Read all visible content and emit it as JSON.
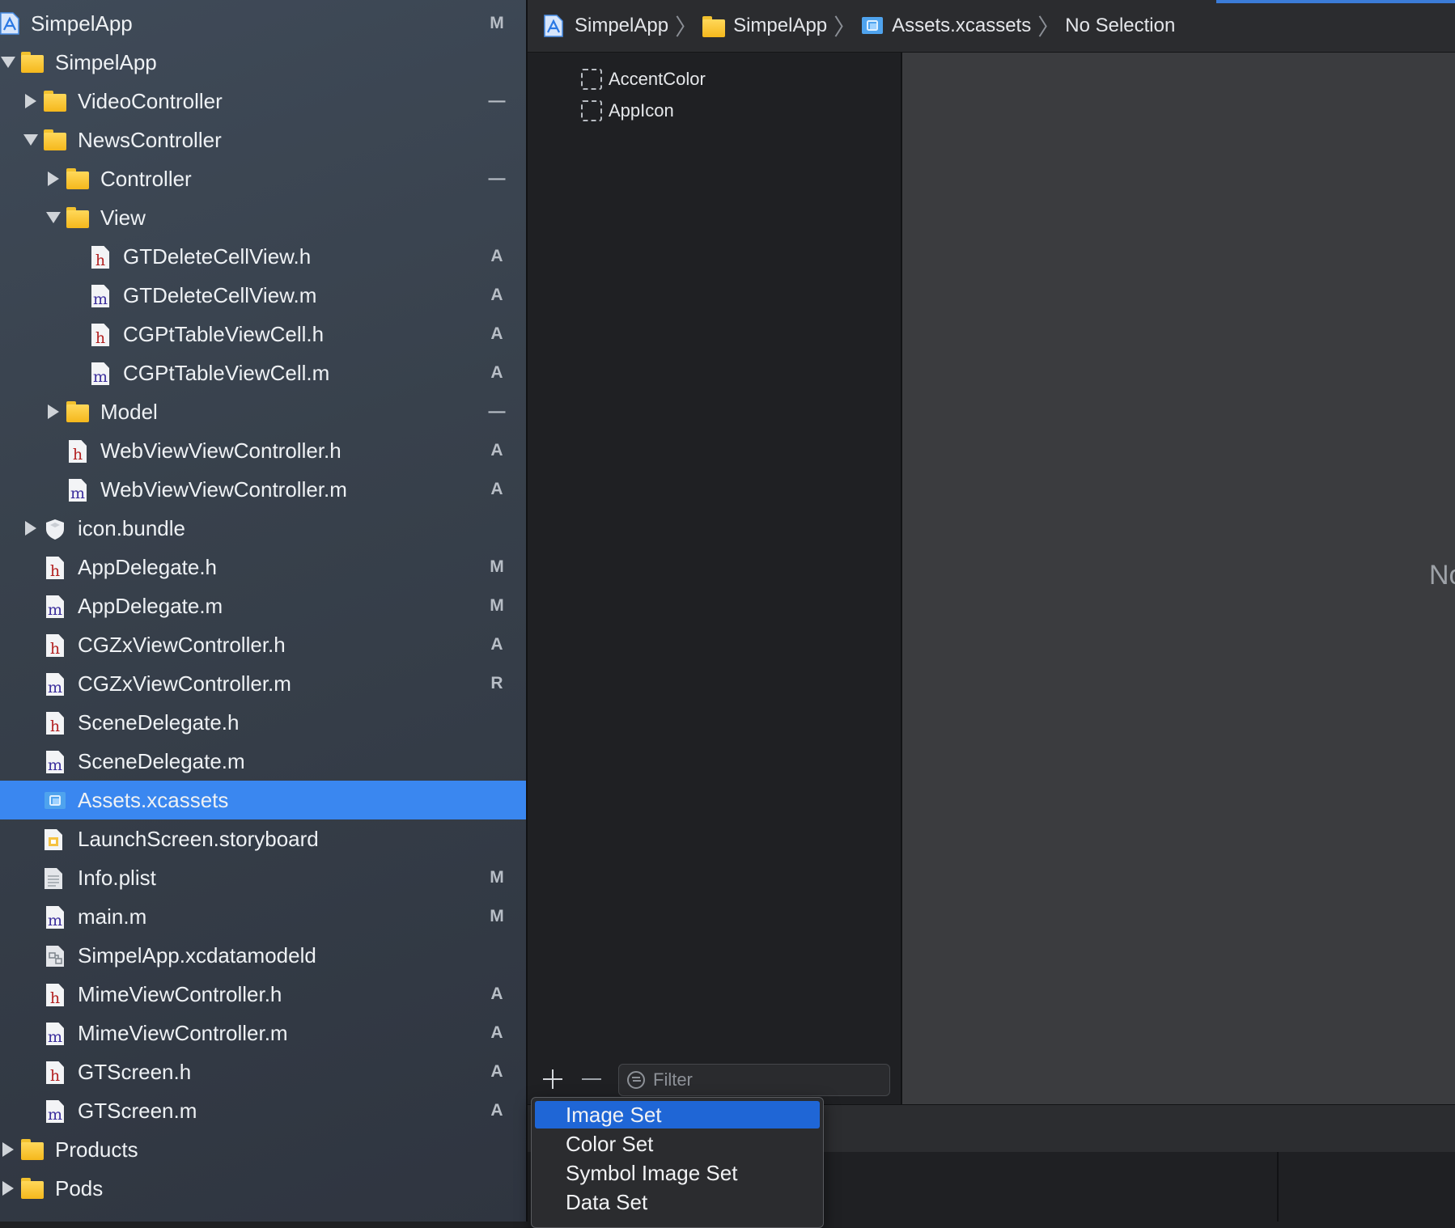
{
  "navigator": {
    "project": {
      "label": "SimpelApp",
      "status": "M"
    },
    "rows": [
      {
        "label": "SimpelApp",
        "type": "folder",
        "indent": 1,
        "disclosure": "open",
        "status": ""
      },
      {
        "label": "VideoController",
        "type": "folder",
        "indent": 2,
        "disclosure": "closed",
        "status": "—"
      },
      {
        "label": "NewsController",
        "type": "folder",
        "indent": 2,
        "disclosure": "open",
        "status": ""
      },
      {
        "label": "Controller",
        "type": "folder",
        "indent": 3,
        "disclosure": "closed",
        "status": "—"
      },
      {
        "label": "View",
        "type": "folder",
        "indent": 3,
        "disclosure": "open",
        "status": ""
      },
      {
        "label": "GTDeleteCellView.h",
        "type": "h",
        "indent": 4,
        "disclosure": "",
        "status": "A"
      },
      {
        "label": "GTDeleteCellView.m",
        "type": "m",
        "indent": 4,
        "disclosure": "",
        "status": "A"
      },
      {
        "label": "CGPtTableViewCell.h",
        "type": "h",
        "indent": 4,
        "disclosure": "",
        "status": "A"
      },
      {
        "label": "CGPtTableViewCell.m",
        "type": "m",
        "indent": 4,
        "disclosure": "",
        "status": "A"
      },
      {
        "label": "Model",
        "type": "folder",
        "indent": 3,
        "disclosure": "closed",
        "status": "—"
      },
      {
        "label": "WebViewViewController.h",
        "type": "h",
        "indent": 3,
        "disclosure": "",
        "status": "A"
      },
      {
        "label": "WebViewViewController.m",
        "type": "m",
        "indent": 3,
        "disclosure": "",
        "status": "A"
      },
      {
        "label": "icon.bundle",
        "type": "bundle",
        "indent": 2,
        "disclosure": "closed",
        "status": ""
      },
      {
        "label": "AppDelegate.h",
        "type": "h",
        "indent": 2,
        "disclosure": "",
        "status": "M"
      },
      {
        "label": "AppDelegate.m",
        "type": "m",
        "indent": 2,
        "disclosure": "",
        "status": "M"
      },
      {
        "label": "CGZxViewController.h",
        "type": "h",
        "indent": 2,
        "disclosure": "",
        "status": "A"
      },
      {
        "label": "CGZxViewController.m",
        "type": "m",
        "indent": 2,
        "disclosure": "",
        "status": "R"
      },
      {
        "label": "SceneDelegate.h",
        "type": "h",
        "indent": 2,
        "disclosure": "",
        "status": ""
      },
      {
        "label": "SceneDelegate.m",
        "type": "m",
        "indent": 2,
        "disclosure": "",
        "status": ""
      },
      {
        "label": "Assets.xcassets",
        "type": "assets",
        "indent": 2,
        "disclosure": "",
        "status": "",
        "selected": true
      },
      {
        "label": "LaunchScreen.storyboard",
        "type": "storyboard",
        "indent": 2,
        "disclosure": "",
        "status": ""
      },
      {
        "label": "Info.plist",
        "type": "plist",
        "indent": 2,
        "disclosure": "",
        "status": "M"
      },
      {
        "label": "main.m",
        "type": "m",
        "indent": 2,
        "disclosure": "",
        "status": "M"
      },
      {
        "label": "SimpelApp.xcdatamodeld",
        "type": "datamodel",
        "indent": 2,
        "disclosure": "",
        "status": ""
      },
      {
        "label": "MimeViewController.h",
        "type": "h",
        "indent": 2,
        "disclosure": "",
        "status": "A"
      },
      {
        "label": "MimeViewController.m",
        "type": "m",
        "indent": 2,
        "disclosure": "",
        "status": "A"
      },
      {
        "label": "GTScreen.h",
        "type": "h",
        "indent": 2,
        "disclosure": "",
        "status": "A"
      },
      {
        "label": "GTScreen.m",
        "type": "m",
        "indent": 2,
        "disclosure": "",
        "status": "A"
      },
      {
        "label": "Products",
        "type": "folder",
        "indent": 1,
        "disclosure": "closed",
        "status": ""
      },
      {
        "label": "Pods",
        "type": "folder",
        "indent": 1,
        "disclosure": "closed",
        "status": ""
      }
    ]
  },
  "breadcrumb": {
    "items": [
      {
        "label": "SimpelApp",
        "icon": "xcode-project-icon"
      },
      {
        "label": "SimpelApp",
        "icon": "folder-icon"
      },
      {
        "label": "Assets.xcassets",
        "icon": "asset-catalog-icon"
      },
      {
        "label": "No Selection",
        "icon": ""
      }
    ]
  },
  "asset_list": {
    "items": [
      "AccentColor",
      "AppIcon"
    ],
    "filter_placeholder": "Filter"
  },
  "detail": {
    "no_selection_partial": "No"
  },
  "add_menu": {
    "items": [
      "Image Set",
      "Color Set",
      "Symbol Image Set",
      "Data Set"
    ],
    "highlighted_index": 0
  },
  "colors": {
    "selection": "#3a87f0",
    "menu_highlight": "#1f66d6",
    "folder": "#f5b81c",
    "header_file_letter": "#b32121",
    "impl_file_letter": "#3b2e9c"
  }
}
